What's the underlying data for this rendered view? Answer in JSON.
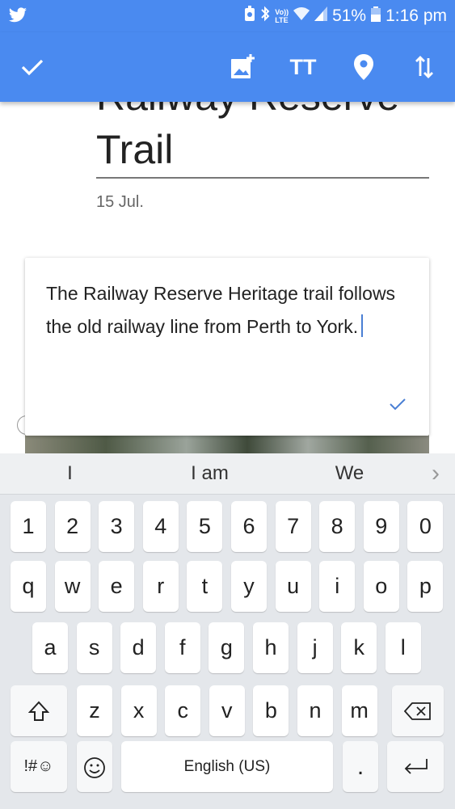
{
  "status_bar": {
    "battery": "51%",
    "time": "1:16 pm",
    "network": "LTE",
    "network_small": "Vo))",
    "icons": [
      "twitter-icon",
      "data-saver-icon",
      "bluetooth-icon",
      "volte-icon",
      "wifi-icon",
      "signal-icon",
      "battery-icon"
    ]
  },
  "toolbar": {
    "icons": [
      "check-icon",
      "add-image-icon",
      "text-format-icon",
      "location-pin-icon",
      "sort-icon"
    ],
    "text_format_glyph": "TT"
  },
  "note": {
    "title_line1": "Railway Reserve",
    "title_line2": "Trail",
    "date": "15 Jul.",
    "paragraph": "The Railway Reserve Heritage trail follows the old railway line from Perth to York."
  },
  "keyboard": {
    "suggestions": [
      "I",
      "I am",
      "We"
    ],
    "suggestion_more_glyph": "›",
    "number_row": [
      "1",
      "2",
      "3",
      "4",
      "5",
      "6",
      "7",
      "8",
      "9",
      "0"
    ],
    "row1": [
      "q",
      "w",
      "e",
      "r",
      "t",
      "y",
      "u",
      "i",
      "o",
      "p"
    ],
    "row2": [
      "a",
      "s",
      "d",
      "f",
      "g",
      "h",
      "j",
      "k",
      "l"
    ],
    "row3": [
      "z",
      "x",
      "c",
      "v",
      "b",
      "n",
      "m"
    ],
    "symbols_label": "!#☺",
    "space_label": "English (US)",
    "period_label": "."
  },
  "colors": {
    "accent": "#4a8af0",
    "check_blue": "#4a7fd4",
    "keyboard_bg": "#e4e7eb"
  }
}
